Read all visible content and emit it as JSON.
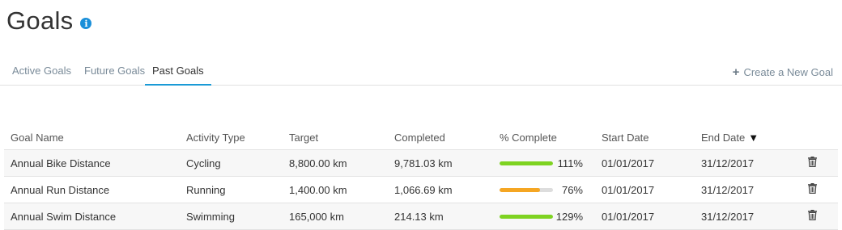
{
  "page": {
    "title": "Goals",
    "info_icon": "info-icon",
    "info_glyph": "i"
  },
  "tabs": [
    {
      "label": "Active Goals",
      "active": false
    },
    {
      "label": "Future Goals",
      "active": false
    },
    {
      "label": "Past Goals",
      "active": true
    }
  ],
  "create_goal": {
    "icon": "plus-icon",
    "glyph": "+",
    "label": "Create a New Goal"
  },
  "table": {
    "columns": [
      "Goal Name",
      "Activity Type",
      "Target",
      "Completed",
      "% Complete",
      "Start Date",
      "End Date"
    ],
    "sort_column": "End Date",
    "sort_glyph": "▼",
    "rows": [
      {
        "name": "Annual Bike Distance",
        "activity": "Cycling",
        "target": "8,800.00 km",
        "completed": "9,781.03 km",
        "percent_label": "111%",
        "percent": 111,
        "start": "01/01/2017",
        "end": "31/12/2017"
      },
      {
        "name": "Annual Run Distance",
        "activity": "Running",
        "target": "1,400.00 km",
        "completed": "1,066.69 km",
        "percent_label": "76%",
        "percent": 76,
        "start": "01/01/2017",
        "end": "31/12/2017"
      },
      {
        "name": "Annual Swim Distance",
        "activity": "Swimming",
        "target": "165,000 km",
        "completed": "214.13 km",
        "percent_label": "129%",
        "percent": 129,
        "start": "01/01/2017",
        "end": "31/12/2017"
      }
    ]
  },
  "colors": {
    "complete": "#7ed321",
    "incomplete": "#f5a623",
    "track": "#dddddd",
    "accent": "#1a9ad6"
  }
}
